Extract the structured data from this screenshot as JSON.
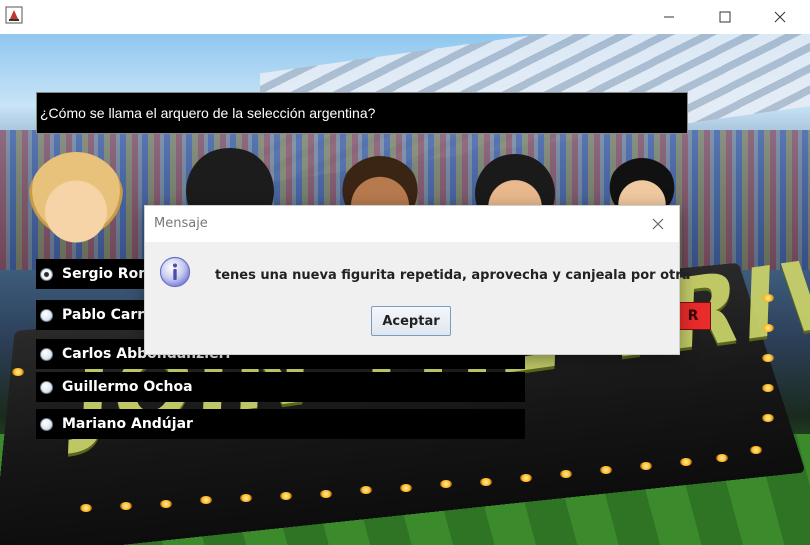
{
  "window": {
    "title": "",
    "controls": [
      "minimize-icon",
      "maximize-icon",
      "close-icon"
    ]
  },
  "game": {
    "question": "¿Cómo se llama el arquero de la selección argentina?",
    "answer_button_label": "R",
    "options": [
      {
        "label": "Sergio Romero",
        "selected": true
      },
      {
        "label": "Pablo Carrizo",
        "selected": false
      },
      {
        "label": "Carlos Abbondanzieri",
        "selected": false
      },
      {
        "label": "Guillermo Ochoa",
        "selected": false
      },
      {
        "label": "Mariano Andújar",
        "selected": false
      }
    ],
    "banner_text": "JOIN THE TRIVIA NOW!"
  },
  "dialog": {
    "title": "Mensaje",
    "icon": "info-icon",
    "message": "tenes una nueva figurita repetida, aprovecha y canjeala por otra",
    "accept_label": "Aceptar"
  },
  "colors": {
    "option_bg": "#000000",
    "dialog_bg": "#f0f0f0",
    "accent_button_border": "#7a9cc0",
    "info_icon": "#6a6fc8"
  }
}
